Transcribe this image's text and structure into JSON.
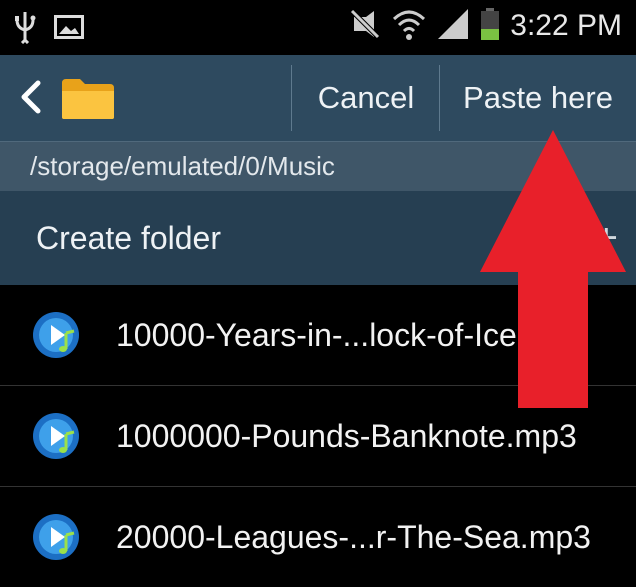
{
  "status_bar": {
    "time": "3:22 PM",
    "icons": [
      "usb-icon",
      "image-icon",
      "mute-vibrate-icon",
      "wifi-icon",
      "signal-icon",
      "battery-icon"
    ]
  },
  "action_bar": {
    "cancel_label": "Cancel",
    "paste_label": "Paste here",
    "icons": [
      "back-icon",
      "folder-icon"
    ]
  },
  "path": "/storage/emulated/0/Music",
  "create_folder_label": "Create folder",
  "create_folder_icon": "plus-icon",
  "files": [
    {
      "name": "10000-Years-in-...lock-of-Ice.mp3",
      "icon": "music-file-icon"
    },
    {
      "name": "1000000-Pounds-Banknote.mp3",
      "icon": "music-file-icon"
    },
    {
      "name": "20000-Leagues-...r-The-Sea.mp3",
      "icon": "music-file-icon"
    }
  ],
  "colors": {
    "action_bar": "#2e4a5f",
    "path_bar": "#3f5668",
    "create_bar": "#263f52",
    "annotation_arrow": "#e8202a"
  },
  "annotation": {
    "type": "red-arrow",
    "points_to": "Paste here"
  }
}
